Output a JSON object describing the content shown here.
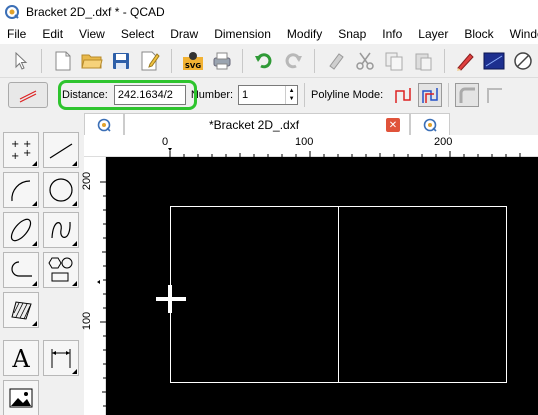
{
  "window": {
    "title": "Bracket 2D_.dxf * - QCAD"
  },
  "menu": [
    "File",
    "Edit",
    "View",
    "Select",
    "Draw",
    "Dimension",
    "Modify",
    "Snap",
    "Info",
    "Layer",
    "Block",
    "Windo"
  ],
  "options": {
    "distance_label": "Distance:",
    "distance_value": "242.1634/2",
    "number_label": "Number:",
    "number_value": "1",
    "polyline_label": "Polyline Mode:"
  },
  "tabs": {
    "active_label": "*Bracket 2D_.dxf"
  },
  "rulers": {
    "top": [
      "0",
      "100",
      "200"
    ],
    "left": [
      "200",
      "100"
    ]
  },
  "colors": {
    "highlight": "#2ec42e",
    "canvas": "#000000",
    "entity": "#ffffff"
  }
}
